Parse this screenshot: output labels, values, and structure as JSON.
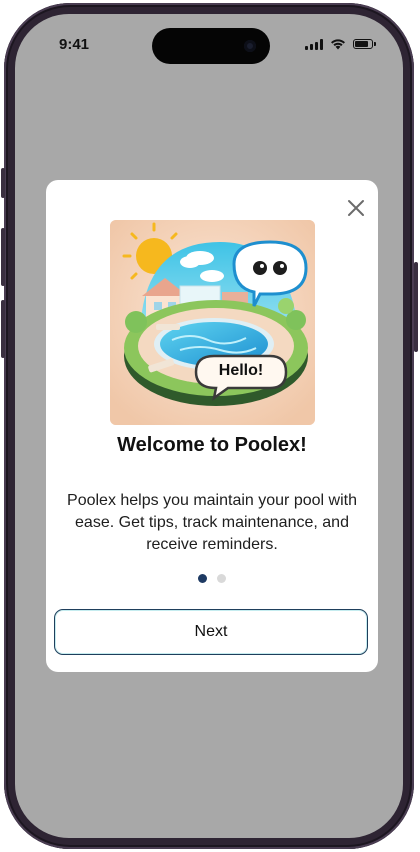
{
  "status_bar": {
    "time": "9:41",
    "icons": [
      "signal-icon",
      "wifi-icon",
      "battery-icon"
    ],
    "battery_level": 0.85
  },
  "modal": {
    "close_icon": "close-icon",
    "illustration": {
      "icon": "pool-illustration",
      "speech_text": "Hello!"
    },
    "title": "Welcome to Poolex!",
    "description": "Poolex helps you maintain your pool with ease. Get tips, track maintenance, and receive reminders.",
    "pagination": {
      "current": 1,
      "total": 2
    },
    "next_label": "Next"
  },
  "colors": {
    "screen_overlay": "#a8a8a8",
    "modal_bg": "#ffffff",
    "dot_active": "#1e3a63",
    "dot_inactive": "#d9d9d9",
    "button_border": "#1f3f5c",
    "frame": "#2e2433"
  }
}
